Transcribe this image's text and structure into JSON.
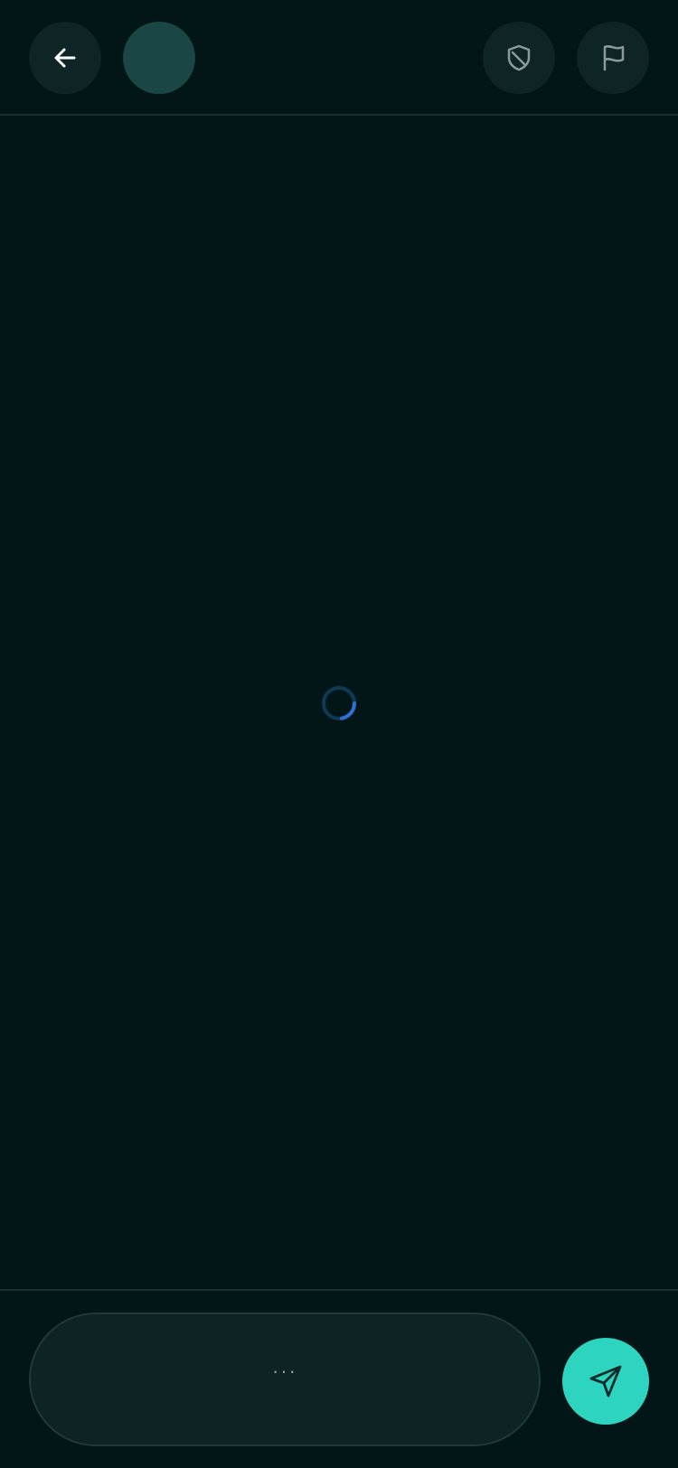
{
  "header": {
    "back_icon": "arrow-left-icon",
    "shield_icon": "shield-slash-icon",
    "flag_icon": "flag-icon"
  },
  "messages": {
    "loading": true
  },
  "composer": {
    "input_text": "···",
    "send_icon": "send-icon"
  },
  "colors": {
    "background": "#021517",
    "button_bg": "#0f2424",
    "avatar": "#1a4645",
    "accent": "#2dd4bf",
    "spinner": "#2f6fd6"
  }
}
